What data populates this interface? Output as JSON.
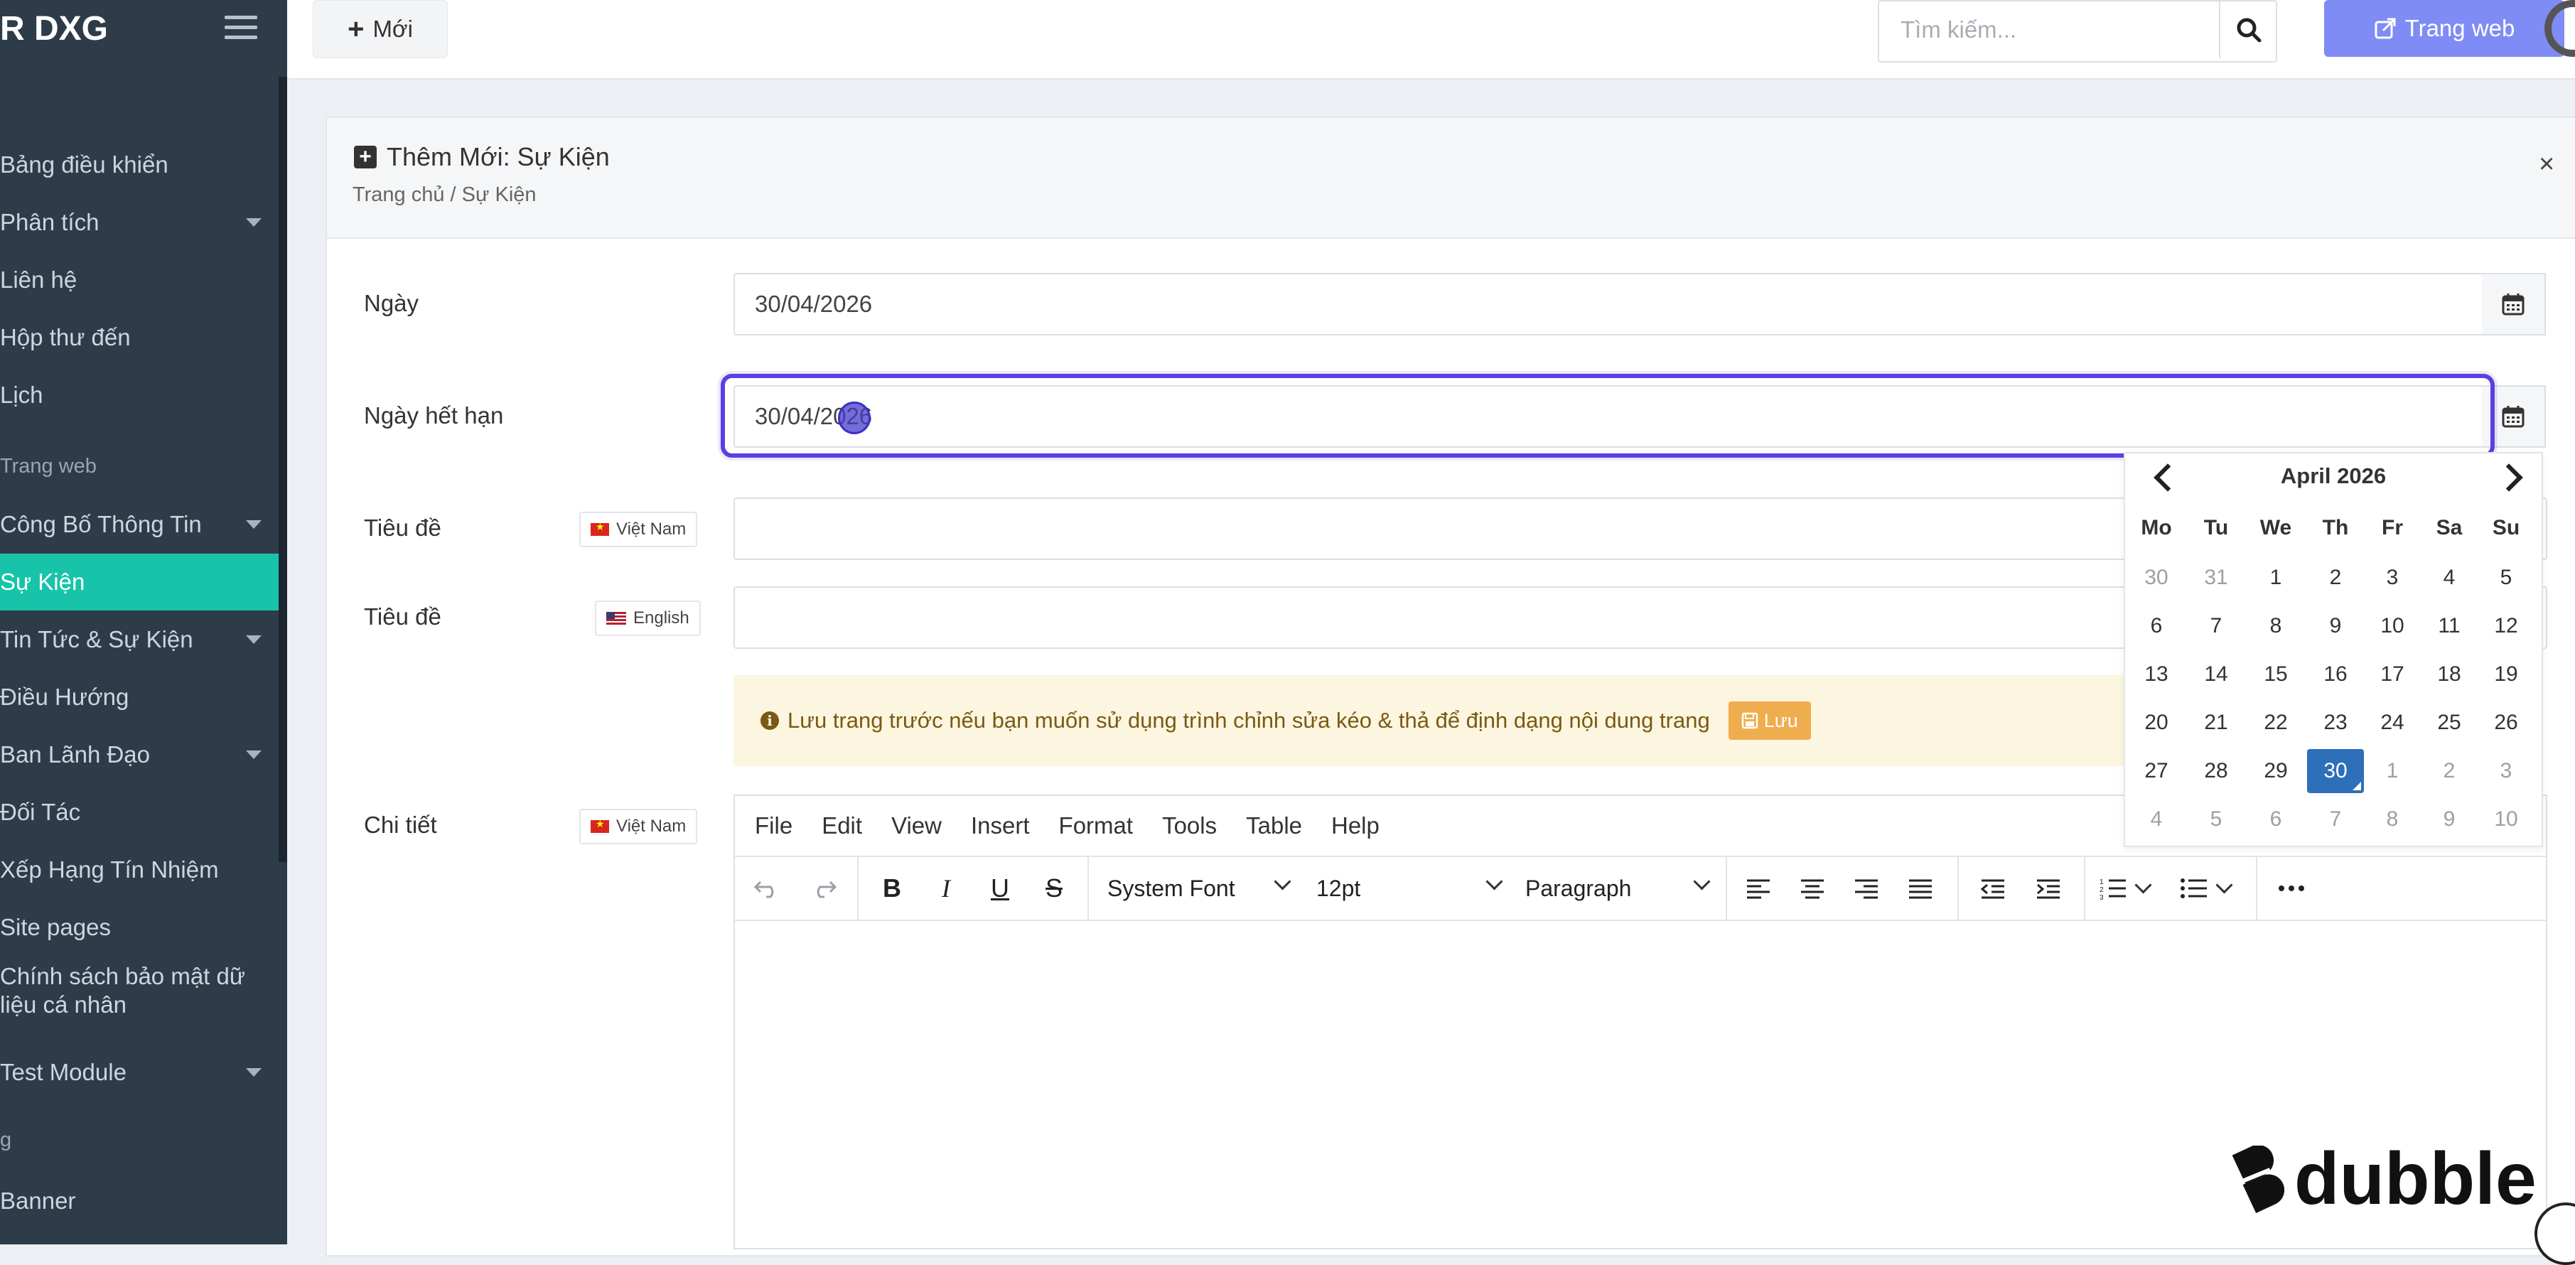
{
  "sidebar": {
    "brand": "R DXG",
    "items": [
      {
        "label": "Bảng điều khiển",
        "dropdown": false
      },
      {
        "label": "Phân tích",
        "dropdown": true
      },
      {
        "label": "Liên hệ",
        "dropdown": false
      },
      {
        "label": "Hộp thư đến",
        "dropdown": false
      },
      {
        "label": "Lịch",
        "dropdown": false
      }
    ],
    "section_web": "Trang web",
    "web_items": [
      {
        "label": "Công Bố Thông Tin",
        "dropdown": true
      },
      {
        "label": "Sự Kiện",
        "dropdown": false,
        "active": true
      },
      {
        "label": "Tin Tức & Sự Kiện",
        "dropdown": true
      },
      {
        "label": "Điều Hướng",
        "dropdown": false
      },
      {
        "label": "Ban Lãnh Đạo",
        "dropdown": true
      },
      {
        "label": "Đối Tác",
        "dropdown": false
      },
      {
        "label": "Xếp Hạng Tín Nhiệm",
        "dropdown": false
      },
      {
        "label": "Site pages",
        "dropdown": false
      },
      {
        "label_line1": "Chính sách bảo mật dữ",
        "label_line2": "liệu cá nhân",
        "dropdown": false
      },
      {
        "label": "Test Module",
        "dropdown": true
      }
    ],
    "section_other": "g",
    "other_items": [
      {
        "label": "Banner",
        "dropdown": false
      }
    ]
  },
  "topbar": {
    "new_label": "Mới",
    "search_placeholder": "Tìm kiếm...",
    "website_label": "Trang web"
  },
  "panel": {
    "title": "Thêm Mới: Sự Kiện",
    "breadcrumb": "Trang chủ / Sự Kiện"
  },
  "form": {
    "date_label": "Ngày",
    "date_value": "30/04/2026",
    "expiry_label": "Ngày hết hạn",
    "expiry_value": "30/04/2026",
    "title_label_vi": "Tiêu đề",
    "title_label_en": "Tiêu đề",
    "lang_vi": "Việt Nam",
    "lang_en": "English",
    "detail_label": "Chi tiết",
    "detail_lang": "Việt Nam"
  },
  "notice": {
    "text": "Lưu trang trước nếu bạn muốn sử dụng trình chỉnh sửa kéo & thả để định dạng nội dung trang",
    "save_label": "Lưu"
  },
  "editor": {
    "menus": [
      "File",
      "Edit",
      "View",
      "Insert",
      "Format",
      "Tools",
      "Table",
      "Help"
    ],
    "font_family": "System Font",
    "font_size": "12pt",
    "block_format": "Paragraph"
  },
  "datepicker": {
    "month_label": "April 2026",
    "weekdays": [
      "Mo",
      "Tu",
      "We",
      "Th",
      "Fr",
      "Sa",
      "Su"
    ],
    "weeks": [
      [
        {
          "d": "30",
          "m": 1
        },
        {
          "d": "31",
          "m": 1
        },
        {
          "d": "1"
        },
        {
          "d": "2"
        },
        {
          "d": "3"
        },
        {
          "d": "4"
        },
        {
          "d": "5"
        }
      ],
      [
        {
          "d": "6"
        },
        {
          "d": "7"
        },
        {
          "d": "8"
        },
        {
          "d": "9"
        },
        {
          "d": "10"
        },
        {
          "d": "11"
        },
        {
          "d": "12"
        }
      ],
      [
        {
          "d": "13"
        },
        {
          "d": "14"
        },
        {
          "d": "15"
        },
        {
          "d": "16"
        },
        {
          "d": "17"
        },
        {
          "d": "18"
        },
        {
          "d": "19"
        }
      ],
      [
        {
          "d": "20"
        },
        {
          "d": "21"
        },
        {
          "d": "22"
        },
        {
          "d": "23"
        },
        {
          "d": "24"
        },
        {
          "d": "25"
        },
        {
          "d": "26"
        }
      ],
      [
        {
          "d": "27"
        },
        {
          "d": "28"
        },
        {
          "d": "29"
        },
        {
          "d": "30",
          "sel": 1
        },
        {
          "d": "1",
          "m": 1
        },
        {
          "d": "2",
          "m": 1
        },
        {
          "d": "3",
          "m": 1
        }
      ],
      [
        {
          "d": "4",
          "m": 1
        },
        {
          "d": "5",
          "m": 1
        },
        {
          "d": "6",
          "m": 1
        },
        {
          "d": "7",
          "m": 1
        },
        {
          "d": "8",
          "m": 1
        },
        {
          "d": "9",
          "m": 1
        },
        {
          "d": "10",
          "m": 1
        }
      ]
    ]
  },
  "watermark": {
    "text": "dubble"
  },
  "colors": {
    "sidebar_bg": "#2e3c4a",
    "active_item": "#17c4a9",
    "website_button": "#7f8cf5",
    "focus_ring": "#5b3fe0",
    "selected_day": "#2d6fb8",
    "notice_bg": "#fcf5e0",
    "save_button": "#f0ad4e"
  }
}
